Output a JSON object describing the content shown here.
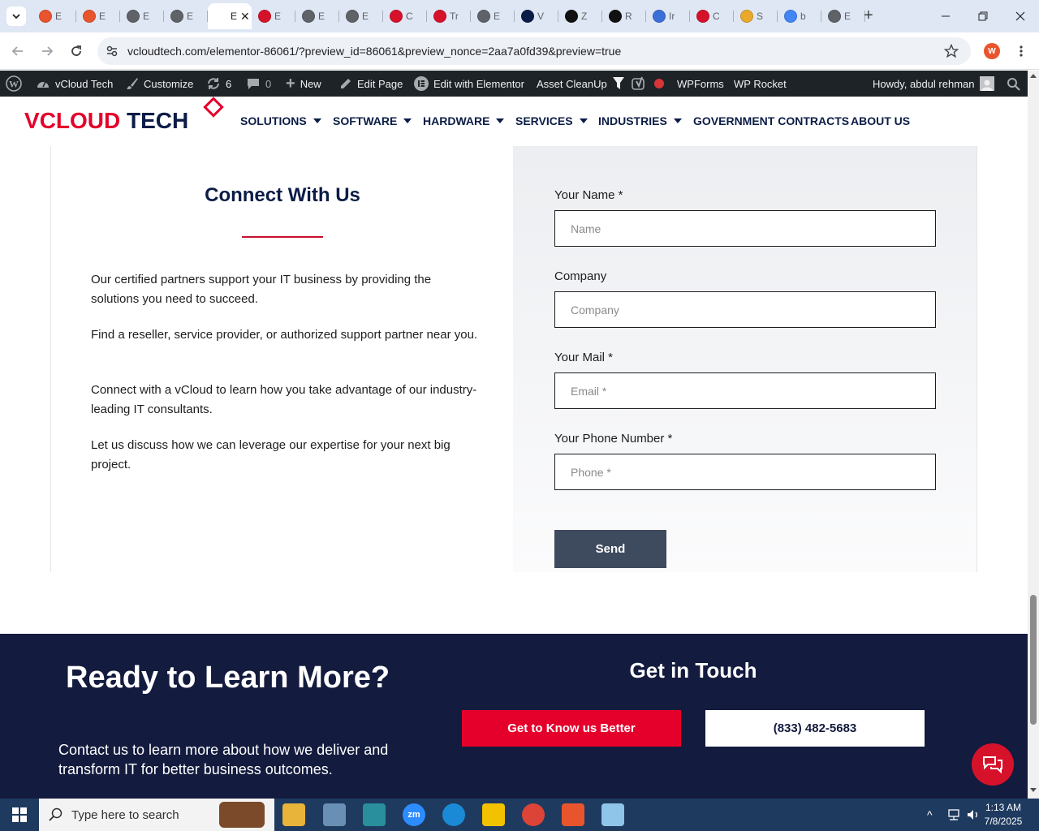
{
  "browser": {
    "tabs": [
      {
        "label": "E",
        "favicon_color": "#e8552d"
      },
      {
        "label": "E",
        "favicon_color": "#e8552d"
      },
      {
        "label": "E",
        "favicon_color": "#5f6368"
      },
      {
        "label": "E",
        "favicon_color": "#5f6368"
      },
      {
        "label": "E",
        "favicon_color": "#ffffff",
        "active": true
      },
      {
        "label": "E",
        "favicon_color": "#d6122a"
      },
      {
        "label": "E",
        "favicon_color": "#5f6368"
      },
      {
        "label": "E",
        "favicon_color": "#5f6368"
      },
      {
        "label": "C",
        "favicon_color": "#d6122a"
      },
      {
        "label": "Tr",
        "favicon_color": "#d6122a"
      },
      {
        "label": "E",
        "favicon_color": "#5f6368"
      },
      {
        "label": "V",
        "favicon_color": "#0b1c46"
      },
      {
        "label": "Z",
        "favicon_color": "#111111"
      },
      {
        "label": "R",
        "favicon_color": "#111111"
      },
      {
        "label": "Ir",
        "favicon_color": "#3b6fd8"
      },
      {
        "label": "C",
        "favicon_color": "#d6122a"
      },
      {
        "label": "S",
        "favicon_color": "#e8a92d"
      },
      {
        "label": "b",
        "favicon_color": "#4285f4"
      },
      {
        "label": "E",
        "favicon_color": "#5f6368"
      }
    ],
    "url": "vcloudtech.com/elementor-86061/?preview_id=86061&preview_nonce=2aa7a0fd39&preview=true",
    "profile_initial": "W"
  },
  "wpbar": {
    "site": "vCloud Tech",
    "customize": "Customize",
    "updates": "6",
    "comments": "0",
    "new": "New",
    "edit_page": "Edit Page",
    "edit_elementor": "Edit with Elementor",
    "asset_cleanup": "Asset CleanUp",
    "wpforms": "WPForms",
    "wprocket": "WP Rocket",
    "howdy": "Howdy, abdul rehman"
  },
  "site": {
    "logo_v": "V",
    "logo_cloud": "CLOUD",
    "logo_tech": "TECH",
    "nav": [
      "SOLUTIONS",
      "SOFTWARE",
      "HARDWARE",
      "SERVICES",
      "INDUSTRIES",
      "GOVERNMENT CONTRACTS",
      "ABOUT US"
    ]
  },
  "connect": {
    "title": "Connect With Us",
    "paragraphs": [
      "Our certified partners support your IT business by providing the solutions you need to succeed.",
      "Find a reseller, service provider, or authorized support partner near you.",
      "Connect with a vCloud to learn how you take advantage of our industry-leading IT consultants.",
      "Let us discuss how we can leverage our expertise for your next big project."
    ]
  },
  "form": {
    "name_label": "Your Name *",
    "name_placeholder": "Name",
    "company_label": "Company",
    "company_placeholder": "Company",
    "mail_label": "Your Mail *",
    "mail_placeholder": "Email *",
    "phone_label": "Your Phone Number *",
    "phone_placeholder": "Phone *",
    "send": "Send"
  },
  "cta": {
    "title": "Ready to Learn More?",
    "description": "Contact us to learn more about how we deliver and transform IT for better business outcomes.",
    "get_in_touch": "Get in Touch",
    "know_button": "Get to Know us Better",
    "phone_button": "(833) 482-5683"
  },
  "taskbar": {
    "search_placeholder": "Type here to search",
    "time": "1:13 AM",
    "date": "7/8/2025"
  },
  "colors": {
    "brand_navy": "#0b1c46",
    "brand_red": "#e4002b",
    "footer_bg": "#131b3e",
    "wp_bar": "#1d2327"
  }
}
